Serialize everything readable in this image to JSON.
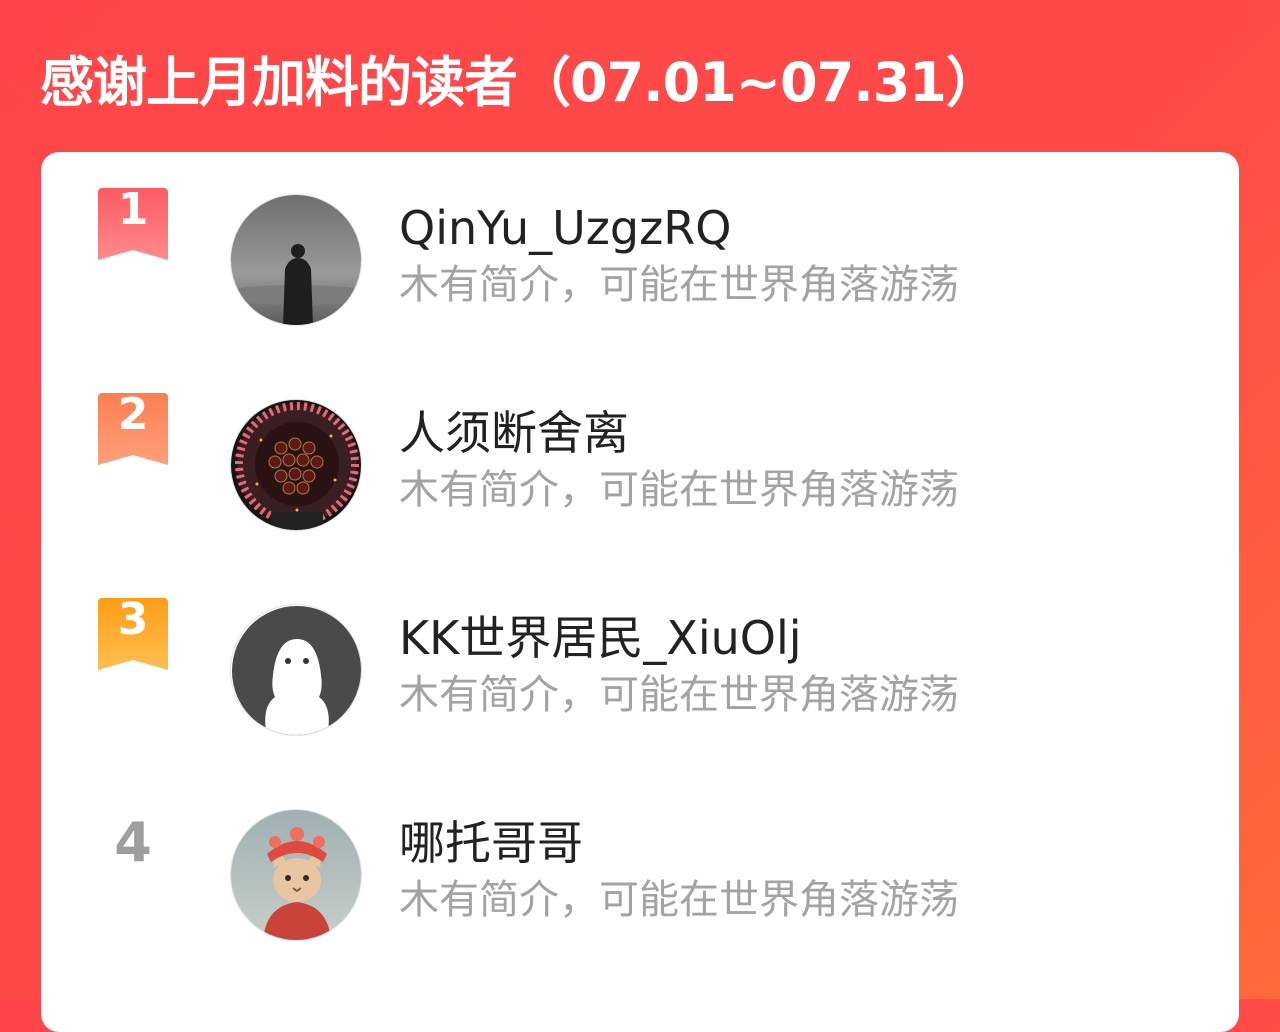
{
  "header": {
    "title": "感谢上月加料的读者（07.01~07.31）"
  },
  "colors": {
    "background_start": "#ff4549",
    "background_end": "#ff6a3a",
    "rank1_badge": "#ff5a62",
    "rank2_badge": "#ff7e52",
    "rank3_badge": "#ffa21c",
    "rank4_text": "#9e9e9e",
    "bio_text": "#a3a3a3"
  },
  "readers": [
    {
      "rank": "1",
      "name": "QinYu_UzgzRQ",
      "bio": "木有简介，可能在世界角落游荡",
      "avatar_icon": "person-silhouette-avatar"
    },
    {
      "rank": "2",
      "name": "人须断舍离",
      "bio": "木有简介，可能在世界角落游荡",
      "avatar_icon": "flower-bouquet-avatar"
    },
    {
      "rank": "3",
      "name": "KK世界居民_XiuOlj",
      "bio": "木有简介，可能在世界角落游荡",
      "avatar_icon": "default-ghost-avatar"
    },
    {
      "rank": "4",
      "name": "哪托哥哥",
      "bio": "木有简介，可能在世界角落游荡",
      "avatar_icon": "cat-costume-avatar"
    }
  ]
}
